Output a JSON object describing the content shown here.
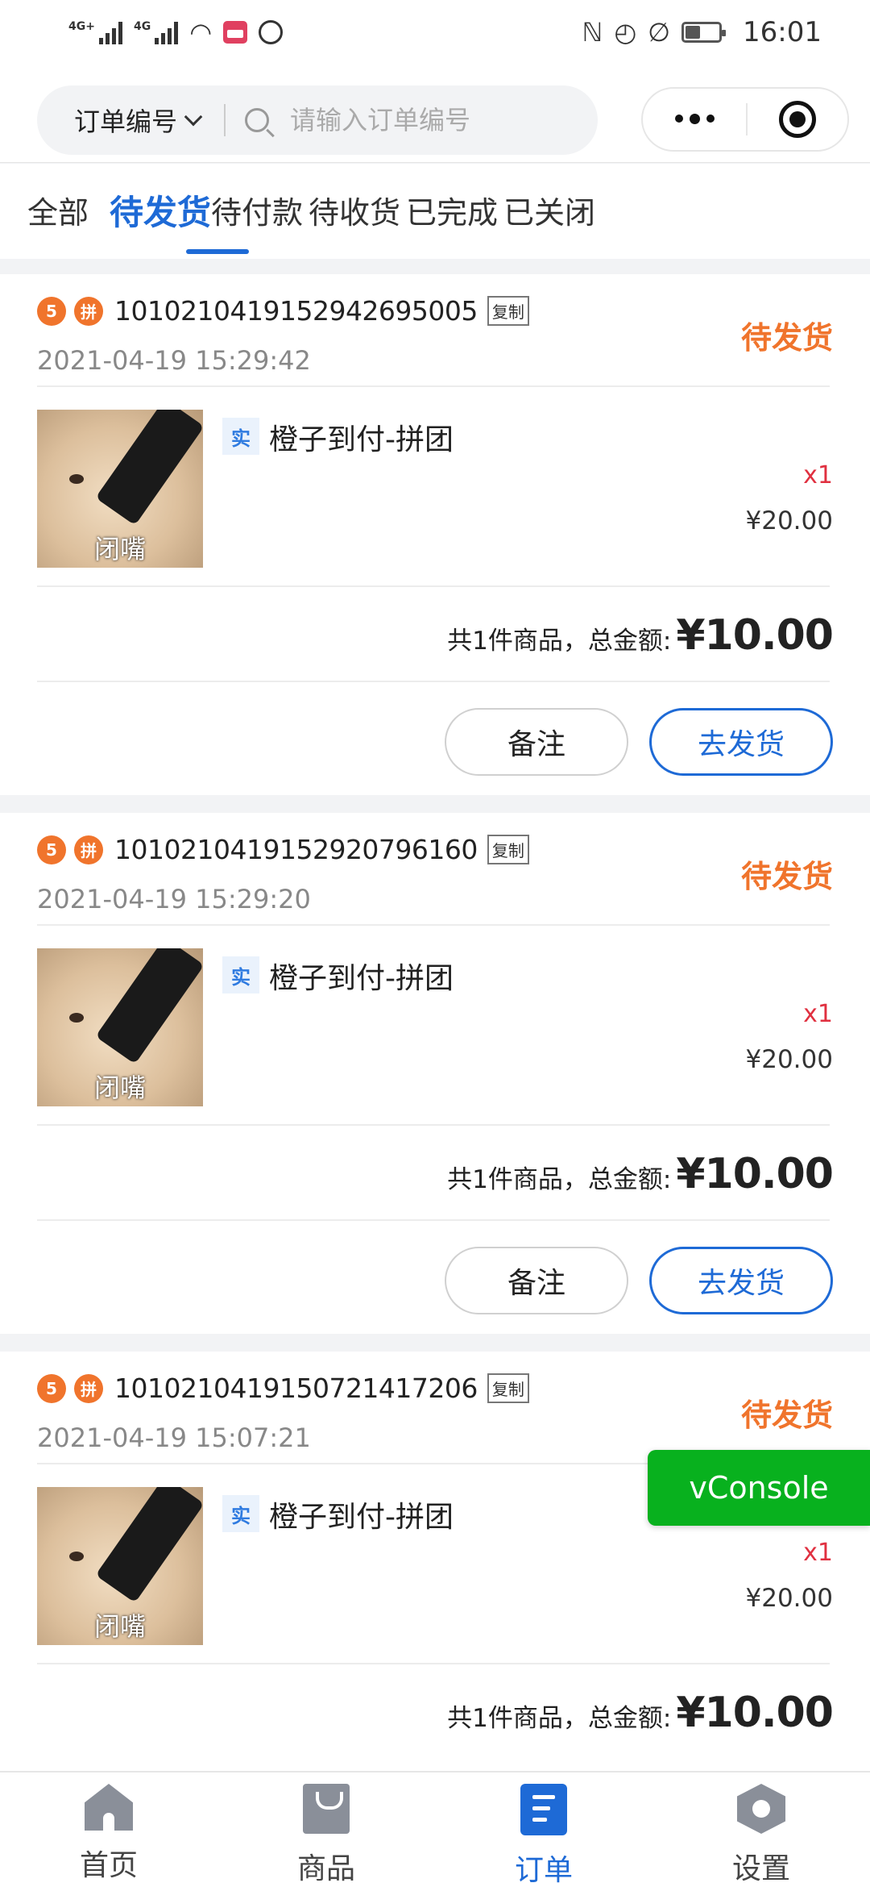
{
  "status_bar": {
    "network_1": "4G+",
    "network_2": "4G",
    "time": "16:01",
    "icons": [
      "signal-icon",
      "signal-icon",
      "wifi-icon",
      "calendar-app-icon",
      "hand-icon",
      "nfc-icon",
      "alarm-icon",
      "mute-icon",
      "battery-icon"
    ]
  },
  "search": {
    "type_label": "订单编号",
    "placeholder": "请输入订单编号"
  },
  "tabs": [
    {
      "label": "全部"
    },
    {
      "label": "待发货",
      "active": true
    },
    {
      "label": "待付款"
    },
    {
      "label": "待收货"
    },
    {
      "label": "已完成"
    },
    {
      "label": "已关闭"
    }
  ],
  "orders": [
    {
      "badge_1": "5",
      "badge_2": "拼",
      "order_no": "10102104191529426950 05",
      "copy_label": "复制",
      "time": "2021-04-19 15:29:42",
      "status": "待发货",
      "goods_thumb_caption": "闭嘴",
      "goods_tag": "实",
      "goods_name": "橙子到付-拼团",
      "qty": "x1",
      "price": "¥20.00",
      "summary_label": "共1件商品，总金额:",
      "total": "¥10.00",
      "note_button": "备注",
      "ship_button": "去发货"
    },
    {
      "badge_1": "5",
      "badge_2": "拼",
      "order_no": "101021041915292079616 0",
      "copy_label": "复制",
      "time": "2021-04-19 15:29:20",
      "status": "待发货",
      "goods_thumb_caption": "闭嘴",
      "goods_tag": "实",
      "goods_name": "橙子到付-拼团",
      "qty": "x1",
      "price": "¥20.00",
      "summary_label": "共1件商品，总金额:",
      "total": "¥10.00",
      "note_button": "备注",
      "ship_button": "去发货"
    },
    {
      "badge_1": "5",
      "badge_2": "拼",
      "order_no": "101021041915072141720 6",
      "copy_label": "复制",
      "time": "2021-04-19 15:07:21",
      "status": "待发货",
      "goods_thumb_caption": "闭嘴",
      "goods_tag": "实",
      "goods_name": "橙子到付-拼团",
      "qty": "x1",
      "price": "¥20.00",
      "summary_label": "共1件商品，总金额:",
      "total": "¥10.00"
    }
  ],
  "vconsole_label": "vConsole",
  "bottom_nav": [
    {
      "label": "首页",
      "icon": "home-icon"
    },
    {
      "label": "商品",
      "icon": "goods-bag-icon"
    },
    {
      "label": "订单",
      "icon": "order-icon",
      "active": true
    },
    {
      "label": "设置",
      "icon": "settings-icon"
    }
  ],
  "colors": {
    "accent_blue": "#1e6ad6",
    "status_orange": "#f0742c",
    "qty_red": "#e03040",
    "vconsole_green": "#08b11e"
  }
}
